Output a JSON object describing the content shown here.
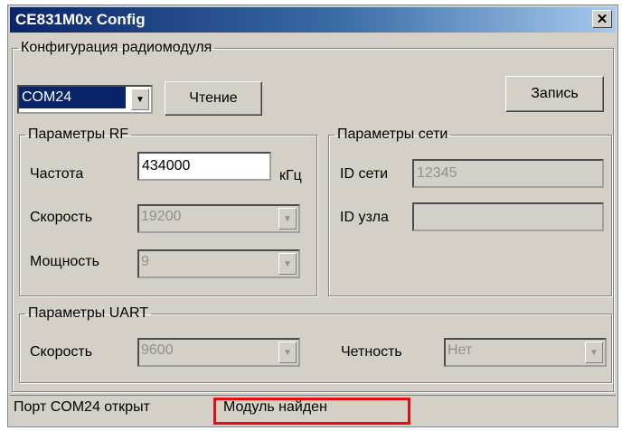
{
  "window": {
    "title": "CE831M0x Config",
    "close_glyph": "✕"
  },
  "config_group": {
    "legend": "Конфигурация радиомодуля"
  },
  "port_select": {
    "value": "COM24"
  },
  "buttons": {
    "read": "Чтение",
    "write": "Запись"
  },
  "rf_group": {
    "legend": "Параметры RF",
    "freq_label": "Частота",
    "freq_value": "434000",
    "freq_unit": "кГц",
    "speed_label": "Скорость",
    "speed_value": "19200",
    "power_label": "Мощность",
    "power_value": "9"
  },
  "net_group": {
    "legend": "Параметры сети",
    "net_id_label": "ID сети",
    "net_id_value": "12345",
    "node_id_label": "ID узла",
    "node_id_value": ""
  },
  "uart_group": {
    "legend": "Параметры UART",
    "speed_label": "Скорость",
    "speed_value": "9600",
    "parity_label": "Четность",
    "parity_value": "Нет"
  },
  "status": {
    "port": "Порт COM24 открыт",
    "module": "Модуль найден",
    "highlight_color": "#e01010"
  }
}
